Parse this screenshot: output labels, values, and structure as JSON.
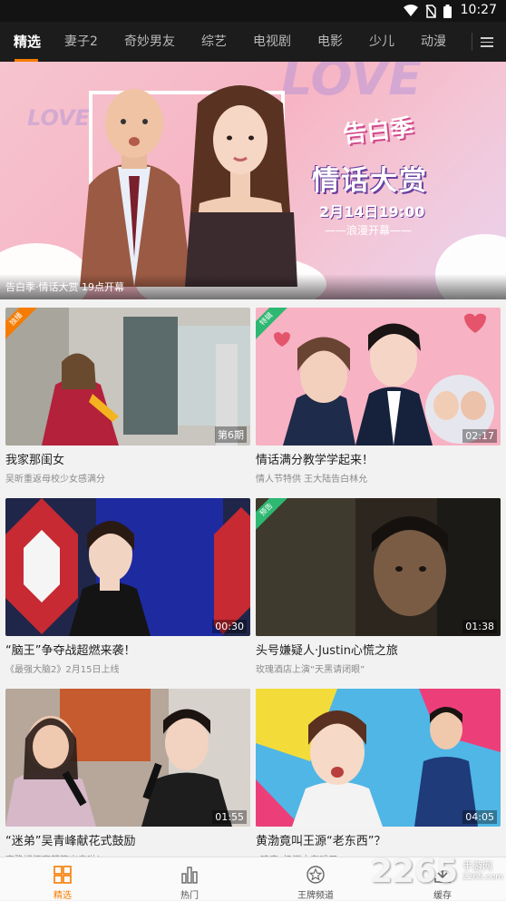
{
  "status_bar": {
    "time": "10:27"
  },
  "nav": {
    "tabs": [
      {
        "label": "精选",
        "active": true
      },
      {
        "label": "妻子2"
      },
      {
        "label": "奇妙男友"
      },
      {
        "label": "综艺"
      },
      {
        "label": "电视剧"
      },
      {
        "label": "电影"
      },
      {
        "label": "少儿"
      },
      {
        "label": "动漫"
      }
    ],
    "menu_icon": "hamburger-menu-icon"
  },
  "banner": {
    "bg_text_1": "LOVE",
    "bg_text_2": "LOVE",
    "logo_text": "告白季",
    "title": "情话大赏",
    "date": "2月14日19:00",
    "sub": "——浪漫开幕——",
    "caption": "告白季·情话大赏 19点开幕"
  },
  "cards": [
    {
      "title": "我家那闺女",
      "subtitle": "吴昕重返母校少女感满分",
      "duration": "第6期",
      "ribbon": "独播",
      "ribbon_color": "orange"
    },
    {
      "title": "情话满分教学学起来！",
      "subtitle": "情人节特供 王大陆告白林允",
      "duration": "02:17",
      "ribbon": "特辑",
      "ribbon_color": "green"
    },
    {
      "title": "“脑王”争夺战超燃来袭！",
      "subtitle": "《最强大脑2》2月15日上线",
      "duration": "00:30",
      "ribbon": "",
      "ribbon_color": ""
    },
    {
      "title": "头号嫌疑人·Justin心慌之旅",
      "subtitle": "玫瑰酒店上演“天黑请闭眼”",
      "duration": "01:38",
      "ribbon": "预告",
      "ribbon_color": "green"
    },
    {
      "title": "“迷弟”吴青峰献花式鼓励",
      "subtitle": "齐豫姐酒窝都笑出来啦！",
      "duration": "01:55",
      "ribbon": "",
      "ribbon_color": ""
    },
    {
      "title": "黄渤竟叫王源“老东西”？",
      "subtitle": "“琉帝”奶源太有戏了",
      "duration": "04:05",
      "ribbon": "",
      "ribbon_color": ""
    }
  ],
  "bottom_nav": [
    {
      "label": "精选",
      "icon": "grid-icon",
      "active": true
    },
    {
      "label": "热门",
      "icon": "bar-chart-icon"
    },
    {
      "label": "王牌频道",
      "icon": "star-badge-icon"
    },
    {
      "label": "缓存",
      "icon": "download-icon"
    }
  ],
  "watermark": {
    "number": "2265",
    "name": "手游网",
    "domain": "2265.com"
  },
  "colors": {
    "accent": "#f57c00",
    "navbar": "#1c1c1c",
    "statusbar": "#131313",
    "ribbon_green": "#2eb872"
  }
}
